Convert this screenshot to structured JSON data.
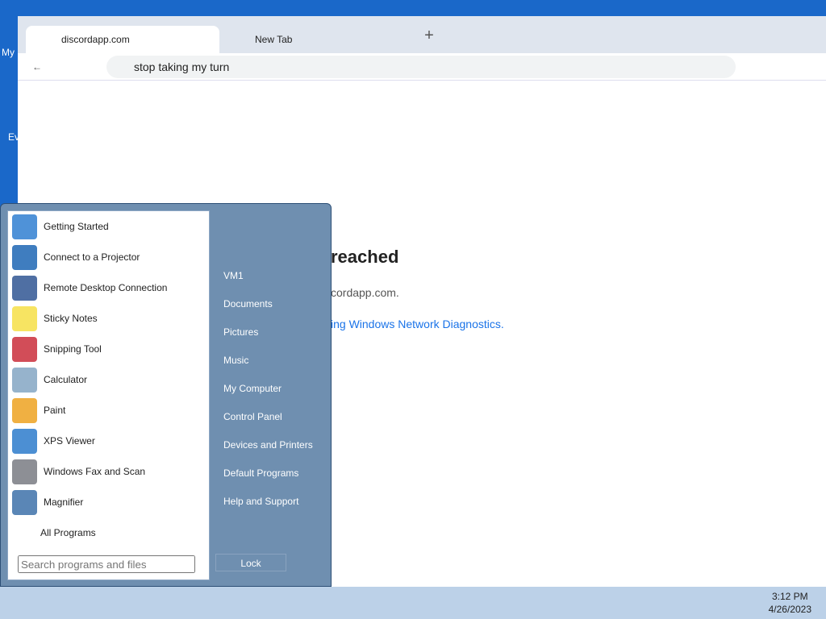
{
  "desktop": {
    "icon1_label": "My",
    "icon2_label": "Ev"
  },
  "browser": {
    "tabs": [
      {
        "title": "discordapp.com"
      },
      {
        "title": "New Tab"
      }
    ],
    "omnibox_value": "stop taking my turn",
    "error_title": "reached",
    "error_line": "cordapp.com.",
    "error_link": "ing Windows Network Diagnostics."
  },
  "start_menu": {
    "programs": [
      {
        "label": "Getting Started",
        "icon": "getting-started-icon",
        "color": "#4f92d8"
      },
      {
        "label": "Connect to a Projector",
        "icon": "projector-icon",
        "color": "#3f7dbf"
      },
      {
        "label": "Remote Desktop Connection",
        "icon": "remote-desktop-icon",
        "color": "#4f6fa3"
      },
      {
        "label": "Sticky Notes",
        "icon": "sticky-notes-icon",
        "color": "#f7e462"
      },
      {
        "label": "Snipping Tool",
        "icon": "snipping-tool-icon",
        "color": "#d24d58"
      },
      {
        "label": "Calculator",
        "icon": "calculator-icon",
        "color": "#96b3cc"
      },
      {
        "label": "Paint",
        "icon": "paint-icon",
        "color": "#f0b042"
      },
      {
        "label": "XPS Viewer",
        "icon": "xps-viewer-icon",
        "color": "#4c8fd3"
      },
      {
        "label": "Windows Fax and Scan",
        "icon": "fax-scan-icon",
        "color": "#8d8f95"
      },
      {
        "label": "Magnifier",
        "icon": "magnifier-icon",
        "color": "#5a86b6"
      }
    ],
    "all_programs": "All Programs",
    "search_placeholder": "Search programs and files",
    "right_items": [
      "VM1",
      "Documents",
      "Pictures",
      "Music",
      "My Computer",
      "Control Panel",
      "Devices and Printers",
      "Default Programs",
      "Help and Support"
    ],
    "lock_label": "Lock"
  },
  "taskbar": {
    "time": "3:12 PM",
    "date": "4/26/2023"
  }
}
